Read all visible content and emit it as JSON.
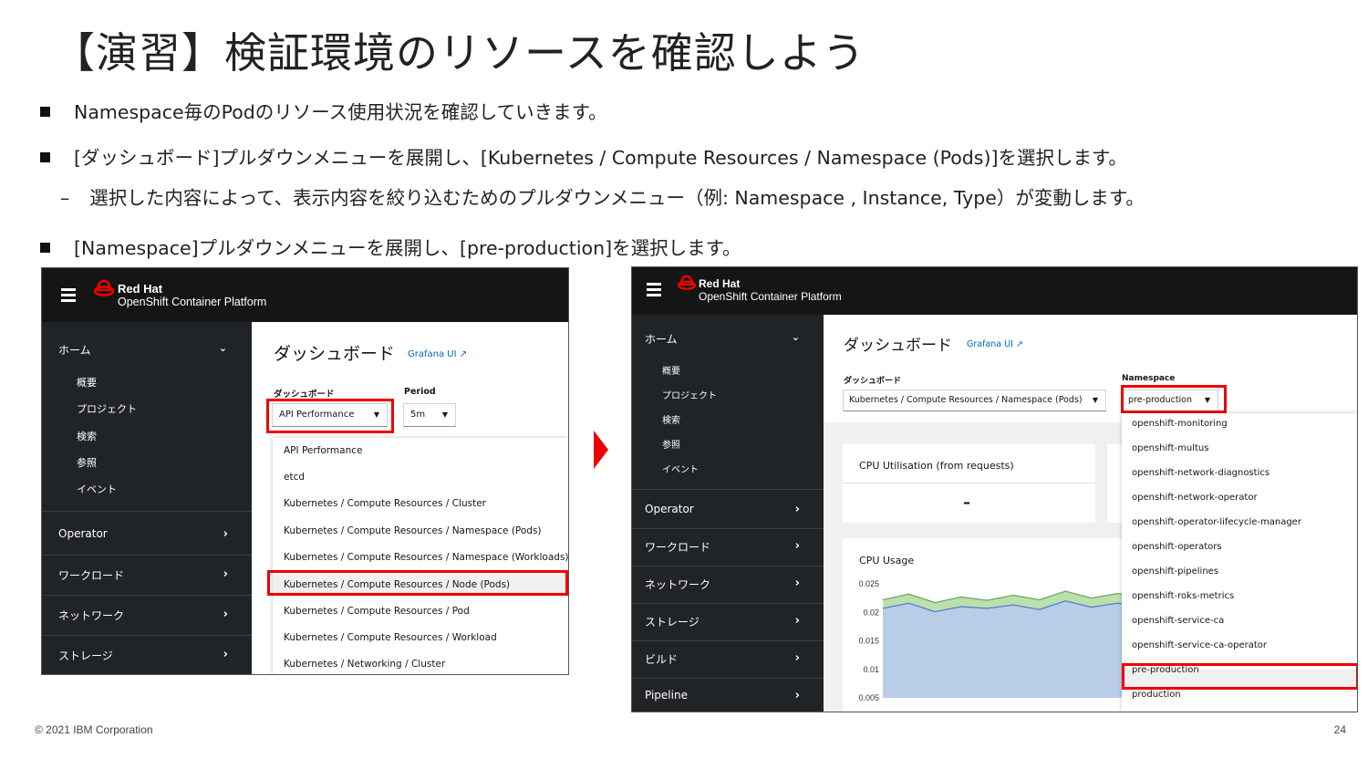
{
  "slide": {
    "title": "【演習】検証環境のリソースを確認しよう",
    "bullets": [
      "Namespace毎のPodのリソース使用状況を確認していきます。",
      "[ダッシュボード]プルダウンメニューを展開し、[Kubernetes / Compute Resources / Namespace (Pods)]を選択します。",
      "[Namespace]プルダウンメニューを展開し、[pre-production]を選択します。"
    ],
    "sub_bullet": "選択した内容によって、表示内容を絞り込むためのプルダウンメニュー（例: Namespace , Instance, Type）が変動します。",
    "sub_dash": "–",
    "footer": "© 2021 IBM Corporation",
    "page_number": "24"
  },
  "brand": {
    "name": "Red Hat",
    "product": "OpenShift Container Platform",
    "accent": "#ee0000",
    "topbar": "#151515",
    "sidebar": "#212427",
    "link": "#0066cc",
    "icons": [
      "hamburger-icon",
      "red-hat-logo-icon",
      "chevron-down-icon",
      "chevron-right-icon",
      "external-link-icon",
      "caret-down-icon",
      "red-arrow-icon"
    ]
  },
  "left_shot": {
    "sidebar": {
      "home": "ホーム",
      "home_items": [
        "概要",
        "プロジェクト",
        "検索",
        "参照",
        "イベント"
      ],
      "sections": [
        "Operator",
        "ワークロード",
        "ネットワーク",
        "ストレージ"
      ]
    },
    "page_title": "ダッシュボード",
    "grafana_link": "Grafana UI",
    "dashboard_label": "ダッシュボード",
    "dashboard_value": "API Performance",
    "period_label": "Period",
    "period_value": "5m",
    "dropdown_items": [
      "API Performance",
      "etcd",
      "Kubernetes / Compute Resources / Cluster",
      "Kubernetes / Compute Resources / Namespace (Pods)",
      "Kubernetes / Compute Resources / Namespace (Workloads)",
      "Kubernetes / Compute Resources / Node (Pods)",
      "Kubernetes / Compute Resources / Pod",
      "Kubernetes / Compute Resources / Workload",
      "Kubernetes / Networking / Cluster"
    ]
  },
  "right_shot": {
    "sidebar": {
      "home": "ホーム",
      "home_items": [
        "概要",
        "プロジェクト",
        "検索",
        "参照",
        "イベント"
      ],
      "sections": [
        "Operator",
        "ワークロード",
        "ネットワーク",
        "ストレージ",
        "ビルド",
        "Pipeline"
      ]
    },
    "page_title": "ダッシュボード",
    "grafana_link": "Grafana UI",
    "dashboard_label": "ダッシュボード",
    "dashboard_value": "Kubernetes / Compute Resources / Namespace (Pods)",
    "namespace_label": "Namespace",
    "namespace_value": "pre-production",
    "card1_title": "CPU Utilisation (from requests)",
    "card1_value": "–",
    "card2_title": "CPU Usage",
    "namespace_items": [
      "openshift-monitoring",
      "openshift-multus",
      "openshift-network-diagnostics",
      "openshift-network-operator",
      "openshift-operator-lifecycle-manager",
      "openshift-operators",
      "openshift-pipelines",
      "openshift-roks-metrics",
      "openshift-service-ca",
      "openshift-service-ca-operator",
      "pre-production",
      "production"
    ],
    "chart_data": {
      "type": "area",
      "title": "CPU Usage",
      "yticks": [
        "0.025",
        "0.02",
        "0.015",
        "0.01",
        "0.005"
      ],
      "ylim": [
        0.005,
        0.025
      ],
      "x": [
        0,
        1,
        2,
        3,
        4,
        5,
        6,
        7,
        8,
        9,
        10
      ],
      "series": [
        {
          "values": [
            0.0222,
            0.0232,
            0.0217,
            0.0227,
            0.0221,
            0.023,
            0.0222,
            0.0237,
            0.0225,
            0.0233,
            0.0226
          ]
        },
        {
          "values": [
            0.0207,
            0.0216,
            0.0201,
            0.021,
            0.0207,
            0.0213,
            0.0205,
            0.022,
            0.0209,
            0.0216,
            0.021
          ]
        }
      ],
      "colors": [
        "#bcdfb0",
        "#b9cce8"
      ]
    }
  }
}
